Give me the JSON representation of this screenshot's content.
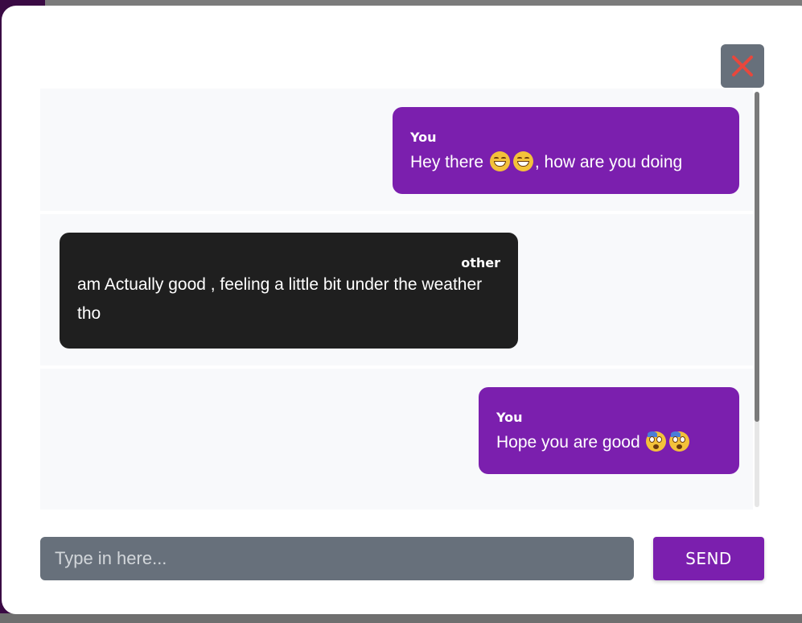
{
  "colors": {
    "accent": "#7b1fae",
    "other_bubble": "#1f1f1f",
    "input_bg": "#67707b",
    "close_icon": "#e8473c"
  },
  "close_button": {
    "icon": "close-icon"
  },
  "messages": [
    {
      "sender": "You",
      "text_before": "Hey there ",
      "emojis": [
        "grinning-face",
        "grinning-face"
      ],
      "text_after": ", how are you doing"
    },
    {
      "sender": "other",
      "text": "am Actually good , feeling a little bit under the weather tho"
    },
    {
      "sender": "You",
      "text_before": "Hope you are good ",
      "emojis": [
        "flushed-sweat-face",
        "flushed-sweat-face"
      ],
      "text_after": ""
    }
  ],
  "composer": {
    "placeholder": "Type in here...",
    "value": "",
    "send_label": "SEND"
  }
}
